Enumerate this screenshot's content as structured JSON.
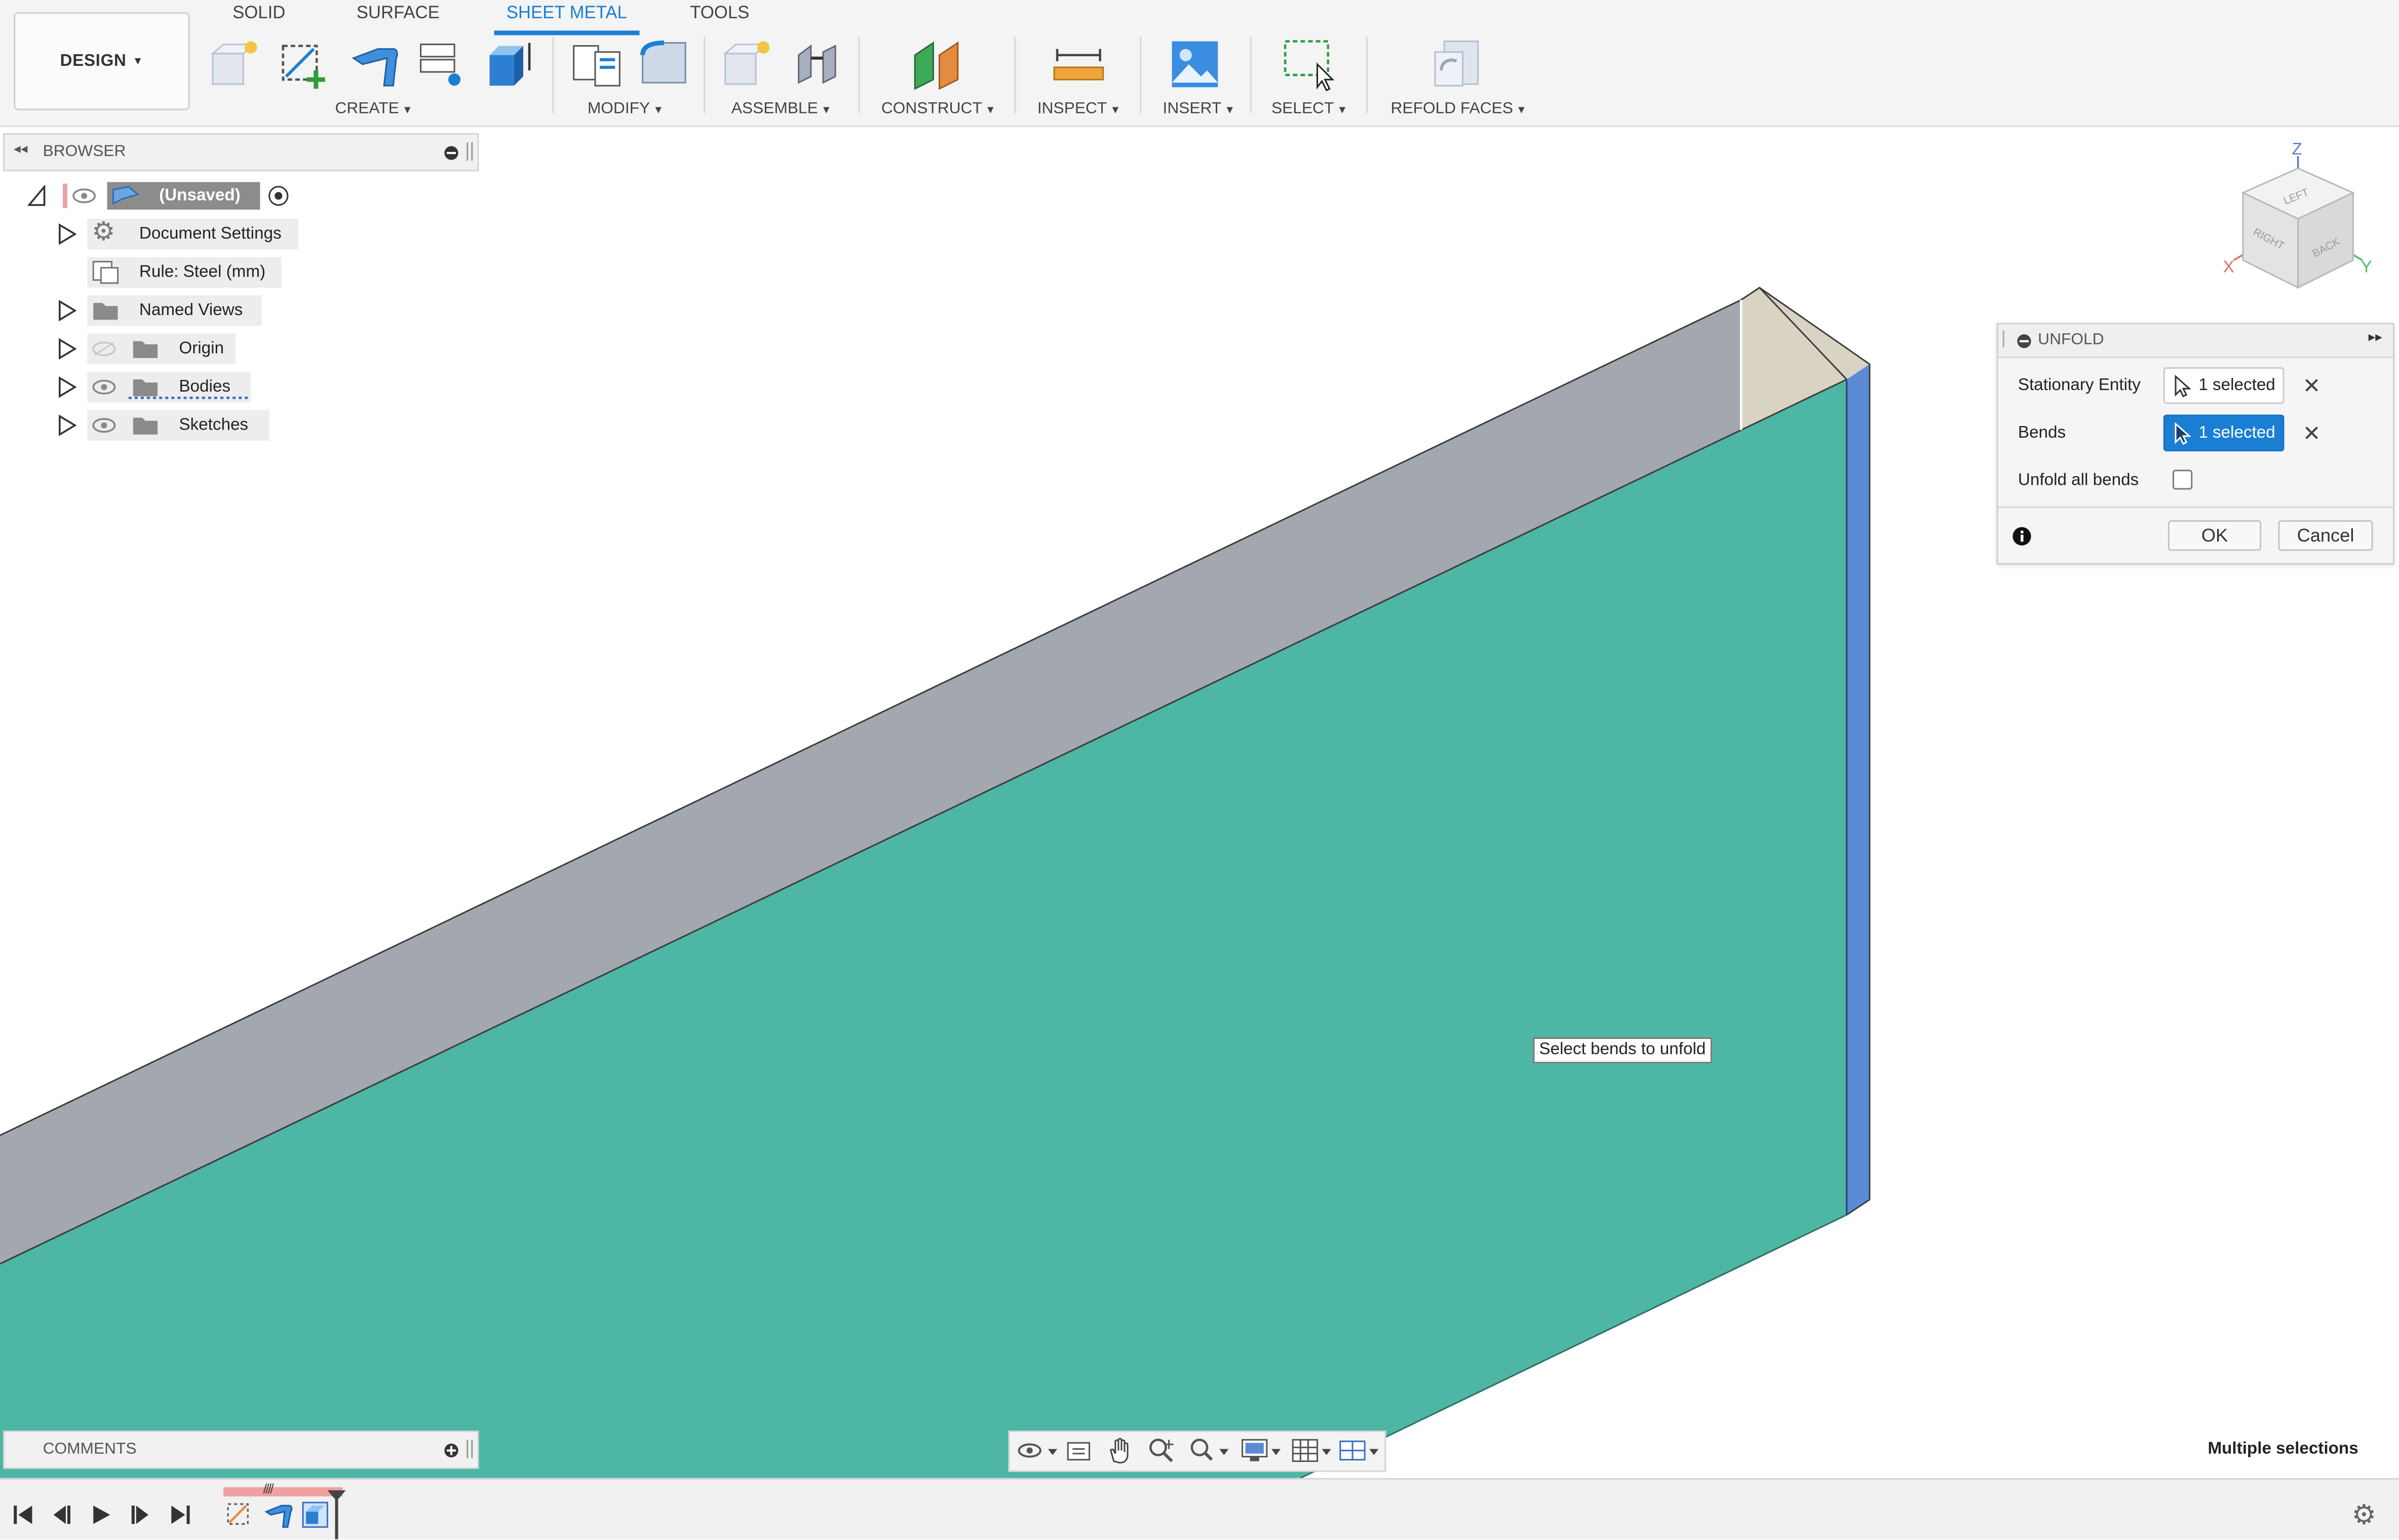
{
  "app": {
    "workspace_button": "DESIGN"
  },
  "tabs": [
    {
      "label": "SOLID",
      "active": false
    },
    {
      "label": "SURFACE",
      "active": false
    },
    {
      "label": "SHEET METAL",
      "active": true
    },
    {
      "label": "TOOLS",
      "active": false
    }
  ],
  "toolbar_groups": [
    {
      "label": "CREATE"
    },
    {
      "label": "MODIFY"
    },
    {
      "label": "ASSEMBLE"
    },
    {
      "label": "CONSTRUCT"
    },
    {
      "label": "INSPECT"
    },
    {
      "label": "INSERT"
    },
    {
      "label": "SELECT"
    },
    {
      "label": "REFOLD FACES"
    }
  ],
  "browser": {
    "title": "BROWSER",
    "items": [
      {
        "label": "(Unsaved)"
      },
      {
        "label": "Document Settings"
      },
      {
        "label": "Rule: Steel (mm)"
      },
      {
        "label": "Named Views"
      },
      {
        "label": "Origin"
      },
      {
        "label": "Bodies"
      },
      {
        "label": "Sketches"
      }
    ]
  },
  "dialog": {
    "title": "UNFOLD",
    "rows": [
      {
        "label": "Stationary Entity",
        "value": "1 selected"
      },
      {
        "label": "Bends",
        "value": "1 selected"
      },
      {
        "label": "Unfold all bends",
        "checked": false
      }
    ],
    "ok": "OK",
    "cancel": "Cancel"
  },
  "tooltip": "Select bends to unfold",
  "comments": {
    "title": "COMMENTS"
  },
  "status": {
    "text": "Multiple selections"
  },
  "viewcube": {
    "axis_x": "X",
    "axis_y": "Y",
    "axis_z": "Z",
    "face_top": "LEFT",
    "face_front": "RIGHT",
    "face_side": "BACK"
  },
  "colors": {
    "accent": "#1a7fd4",
    "face_green": "#4db6a4",
    "face_gray": "#a3a8b0",
    "edge_blue": "#5b8bd6"
  }
}
